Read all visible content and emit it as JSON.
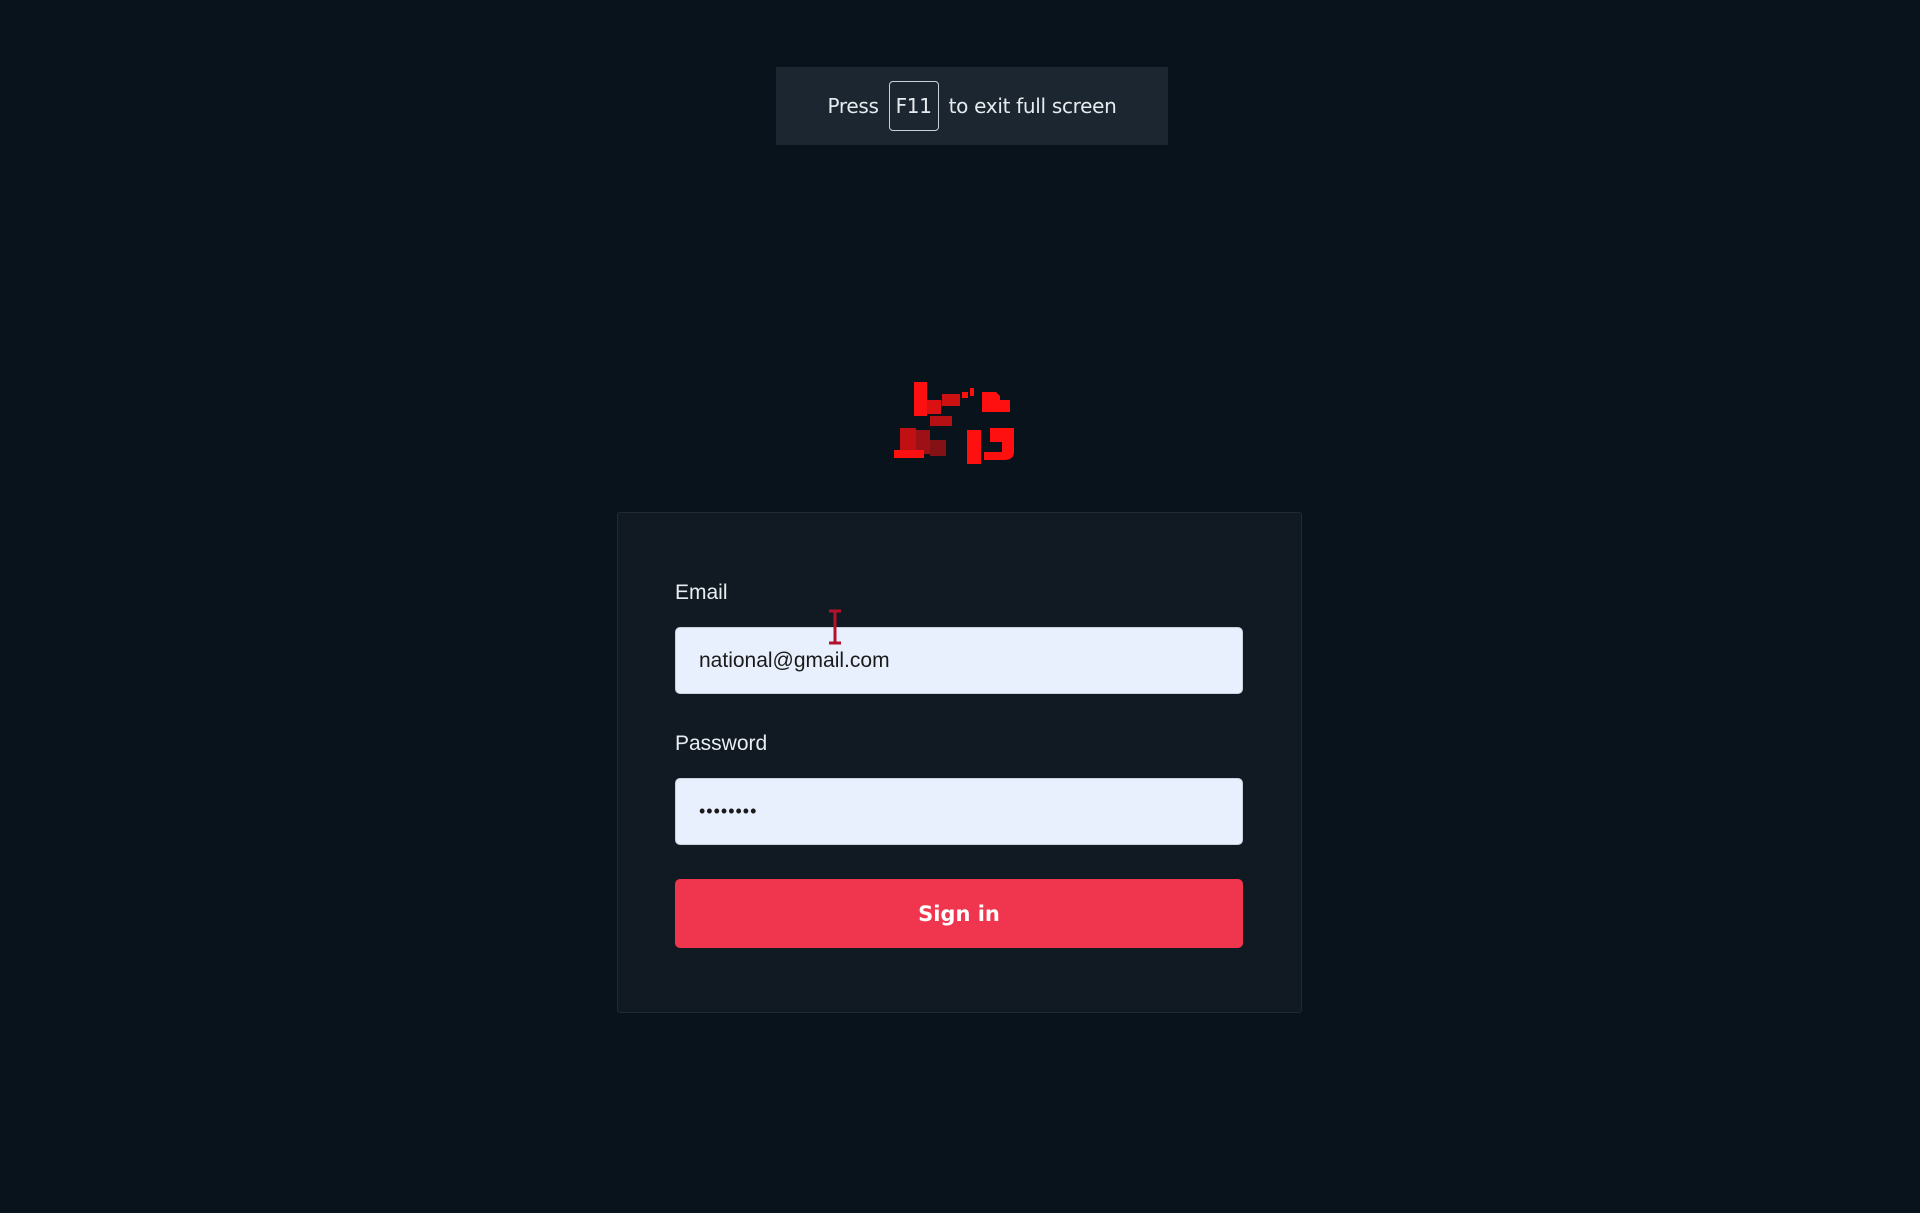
{
  "fullscreen_notice": {
    "prefix": "Press",
    "key": "F11",
    "suffix": "to exit full screen"
  },
  "logo": {
    "icon": "brand-logo",
    "color": "#ff0000"
  },
  "login": {
    "email_label": "Email",
    "email_value": "national@gmail.com",
    "password_label": "Password",
    "password_value": "••••••••",
    "signin_label": "Sign in"
  },
  "colors": {
    "background": "#08131c",
    "card": "#111a23",
    "accent": "#f0354f",
    "input_bg": "#e8f0fe"
  }
}
